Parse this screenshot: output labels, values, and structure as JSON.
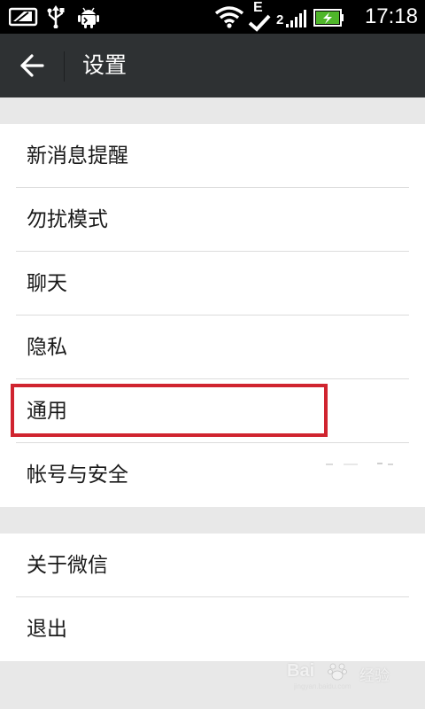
{
  "status_bar": {
    "time": "17:18",
    "network_label": "E",
    "sim_label": "2",
    "icons": [
      "tablet-icon",
      "usb-icon",
      "android-debug-icon",
      "wifi-icon",
      "signal-icon",
      "battery-charging-icon"
    ]
  },
  "action_bar": {
    "title": "设置",
    "back_icon": "arrow-left-icon"
  },
  "groups": [
    {
      "items": [
        {
          "label": "新消息提醒"
        },
        {
          "label": "勿扰模式"
        },
        {
          "label": "聊天"
        },
        {
          "label": "隐私"
        },
        {
          "label": "通用"
        },
        {
          "label": "帐号与安全"
        }
      ]
    },
    {
      "items": [
        {
          "label": "关于微信"
        },
        {
          "label": "退出"
        }
      ]
    }
  ],
  "annotation": {
    "highlighted_item": "通用",
    "color": "#d0242f"
  },
  "watermark": {
    "brand": "Bai",
    "product": "经验",
    "url": "jingyan.baidu.com"
  },
  "colors": {
    "status_bar": "#000000",
    "action_bar": "#2e3133",
    "background": "#e8e8e8",
    "list_bg": "#ffffff"
  }
}
